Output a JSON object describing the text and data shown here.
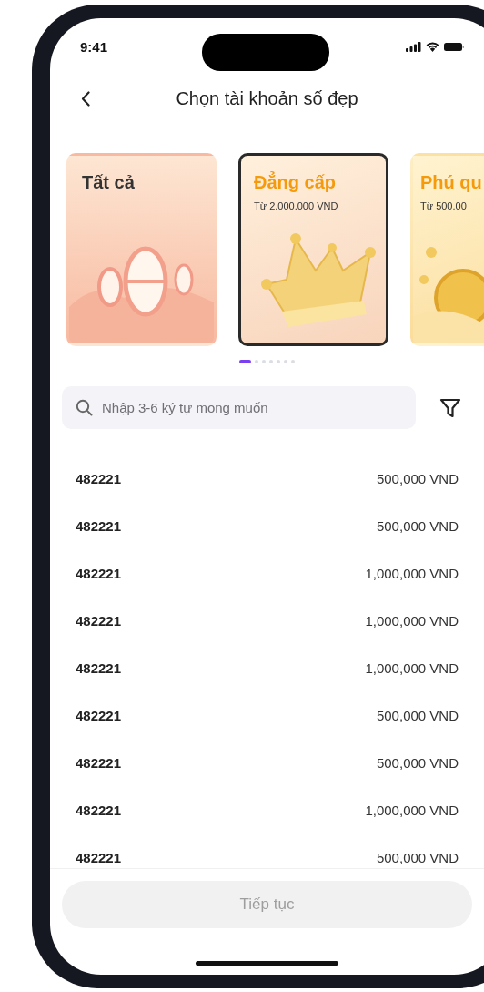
{
  "status_bar": {
    "time": "9:41"
  },
  "header": {
    "title": "Chọn tài khoản số đẹp"
  },
  "categories": [
    {
      "title": "Tất cả",
      "kind": "numbers",
      "selected": false
    },
    {
      "title": "Đẳng cấp",
      "subtitle": "Từ 2.000.000 VND",
      "kind": "crown",
      "selected": true
    },
    {
      "title": "Phú qu",
      "subtitle": "Từ 500.00",
      "kind": "coins",
      "selected": false
    }
  ],
  "pagination": [
    {
      "selected": true
    },
    {
      "selected": false
    },
    {
      "selected": false
    },
    {
      "selected": false
    },
    {
      "selected": false
    },
    {
      "selected": false
    },
    {
      "selected": false
    }
  ],
  "search": {
    "placeholder": "Nhập 3-6 ký tự mong muốn"
  },
  "numbers": [
    {
      "number": "482221",
      "price": "500,000 VND"
    },
    {
      "number": "482221",
      "price": "500,000 VND"
    },
    {
      "number": "482221",
      "price": "1,000,000 VND"
    },
    {
      "number": "482221",
      "price": "1,000,000 VND"
    },
    {
      "number": "482221",
      "price": "1,000,000 VND"
    },
    {
      "number": "482221",
      "price": "500,000 VND"
    },
    {
      "number": "482221",
      "price": "500,000 VND"
    },
    {
      "number": "482221",
      "price": "1,000,000 VND"
    },
    {
      "number": "482221",
      "price": "500,000 VND"
    }
  ],
  "continue_button": {
    "label": "Tiếp tục",
    "disabled": true
  }
}
